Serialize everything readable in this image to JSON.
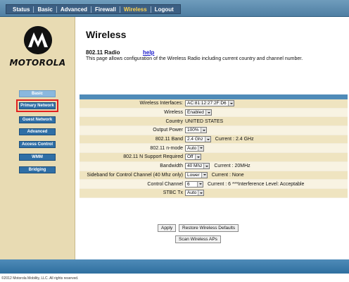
{
  "topnav": {
    "tabs": [
      {
        "label": "Status"
      },
      {
        "label": "Basic"
      },
      {
        "label": "Advanced"
      },
      {
        "label": "Firewall"
      },
      {
        "label": "Wireless"
      },
      {
        "label": "Logout"
      }
    ],
    "active_tab": "Wireless"
  },
  "sidebar": {
    "brand": "MOTOROLA",
    "items": [
      {
        "label": "Basic"
      },
      {
        "label": "Primary Network"
      },
      {
        "label": "Guest Network"
      },
      {
        "label": "Advanced"
      },
      {
        "label": "Access Control"
      },
      {
        "label": "WMM"
      },
      {
        "label": "Bridging"
      }
    ],
    "highlighted_item": "Primary Network"
  },
  "main": {
    "title": "Wireless",
    "subtitle": "802.11 Radio",
    "help_link": "help",
    "description": "This page allows configuration of the Wireless Radio including current country and channel number.",
    "form": {
      "wireless_interfaces": {
        "label": "Wireless Interfaces:",
        "value": "AC:81:12:27:2F:D6"
      },
      "wireless": {
        "label": "Wireless",
        "value": "Enabled"
      },
      "country": {
        "label": "Country",
        "value": "UNITED STATES"
      },
      "output_power": {
        "label": "Output Power",
        "value": "100%"
      },
      "band": {
        "label": "802.11 Band",
        "value": "2.4 Ghz",
        "extra": "Current :  2.4 GHz"
      },
      "n_mode": {
        "label": "802.11 n-mode",
        "value": "Auto"
      },
      "n_support": {
        "label": "802.11 N Support Required",
        "value": "Off"
      },
      "bandwidth": {
        "label": "Bandwidth",
        "value": "40 Mhz",
        "extra": "Current :  20MHz"
      },
      "sideband": {
        "label": "Sideband for Control Channel (40 Mhz only)",
        "value": "Lower",
        "extra": "Current : None"
      },
      "control_channel": {
        "label": "Control Channel",
        "value": "6",
        "extra": "Current :  6 ***Interference Level: Acceptable"
      },
      "stbc_tx": {
        "label": "STBC Tx",
        "value": "Auto"
      }
    },
    "buttons": {
      "apply": "Apply",
      "restore": "Restore Wireless Defaults",
      "scan": "Scan Wireless APs"
    }
  },
  "footer": {
    "copyright": "©2012 Motorola Mobility, LLC. All rights reserved."
  },
  "colors": {
    "nav_bar": "#4f7fa3",
    "sidebar_bg": "#e8dbb3",
    "sidebar_button": "#2f6fa6",
    "highlight_box": "#e02020",
    "table_header": "#4f8bb8",
    "row_odd": "#efe4c0",
    "row_even": "#f8f3e2",
    "link": "#1a1acc"
  },
  "icons": {
    "logo": "motorola-batwing-logo",
    "dropdown": "chevron-down-icon"
  }
}
